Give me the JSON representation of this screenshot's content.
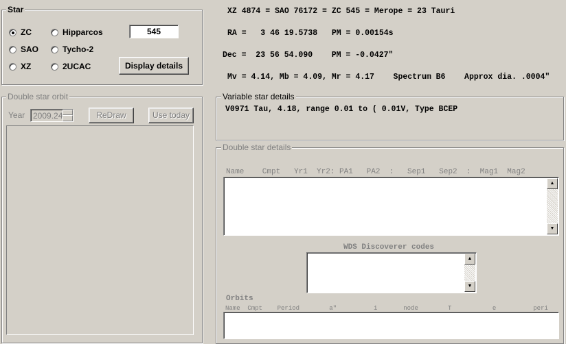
{
  "star_group": {
    "title": "Star",
    "radios": [
      {
        "label": "ZC",
        "checked": true
      },
      {
        "label": "SAO",
        "checked": false
      },
      {
        "label": "XZ",
        "checked": false
      },
      {
        "label": "Hipparcos",
        "checked": false
      },
      {
        "label": "Tycho-2",
        "checked": false
      },
      {
        "label": "2UCAC",
        "checked": false
      }
    ],
    "star_number": "545",
    "display_details_label": "Display details"
  },
  "info": {
    "line1": "XZ 4874 = SAO 76172 = ZC 545 = Merope = 23 Tauri",
    "line2": "RA =   3 46 19.5738   PM = 0.00154s",
    "line3": "Dec =  23 56 54.090    PM = -0.0427\"",
    "line4": "Mv = 4.14, Mb = 4.09, Mr = 4.17    Spectrum B6    Approx dia. .0004\""
  },
  "orbit_group": {
    "title": "Double star orbit",
    "year_label": "Year",
    "year_value": "2009.24",
    "redraw_label": "ReDraw",
    "use_today_label": "Use today"
  },
  "variable_group": {
    "title": "Variable star details",
    "text": "V0971 Tau, 4.18, range 0.01 to ( 0.01V, Type BCEP"
  },
  "double_group": {
    "title": "Double star details",
    "header": "Name    Cmpt   Yr1  Yr2: PA1   PA2  :   Sep1   Sep2  :  Mag1  Mag2",
    "wds_label": "WDS Discoverer codes",
    "orbits_label": "Orbits",
    "orbits_header": "Name  Cmpt    Period        a\"          i       node        T           e          peri"
  }
}
